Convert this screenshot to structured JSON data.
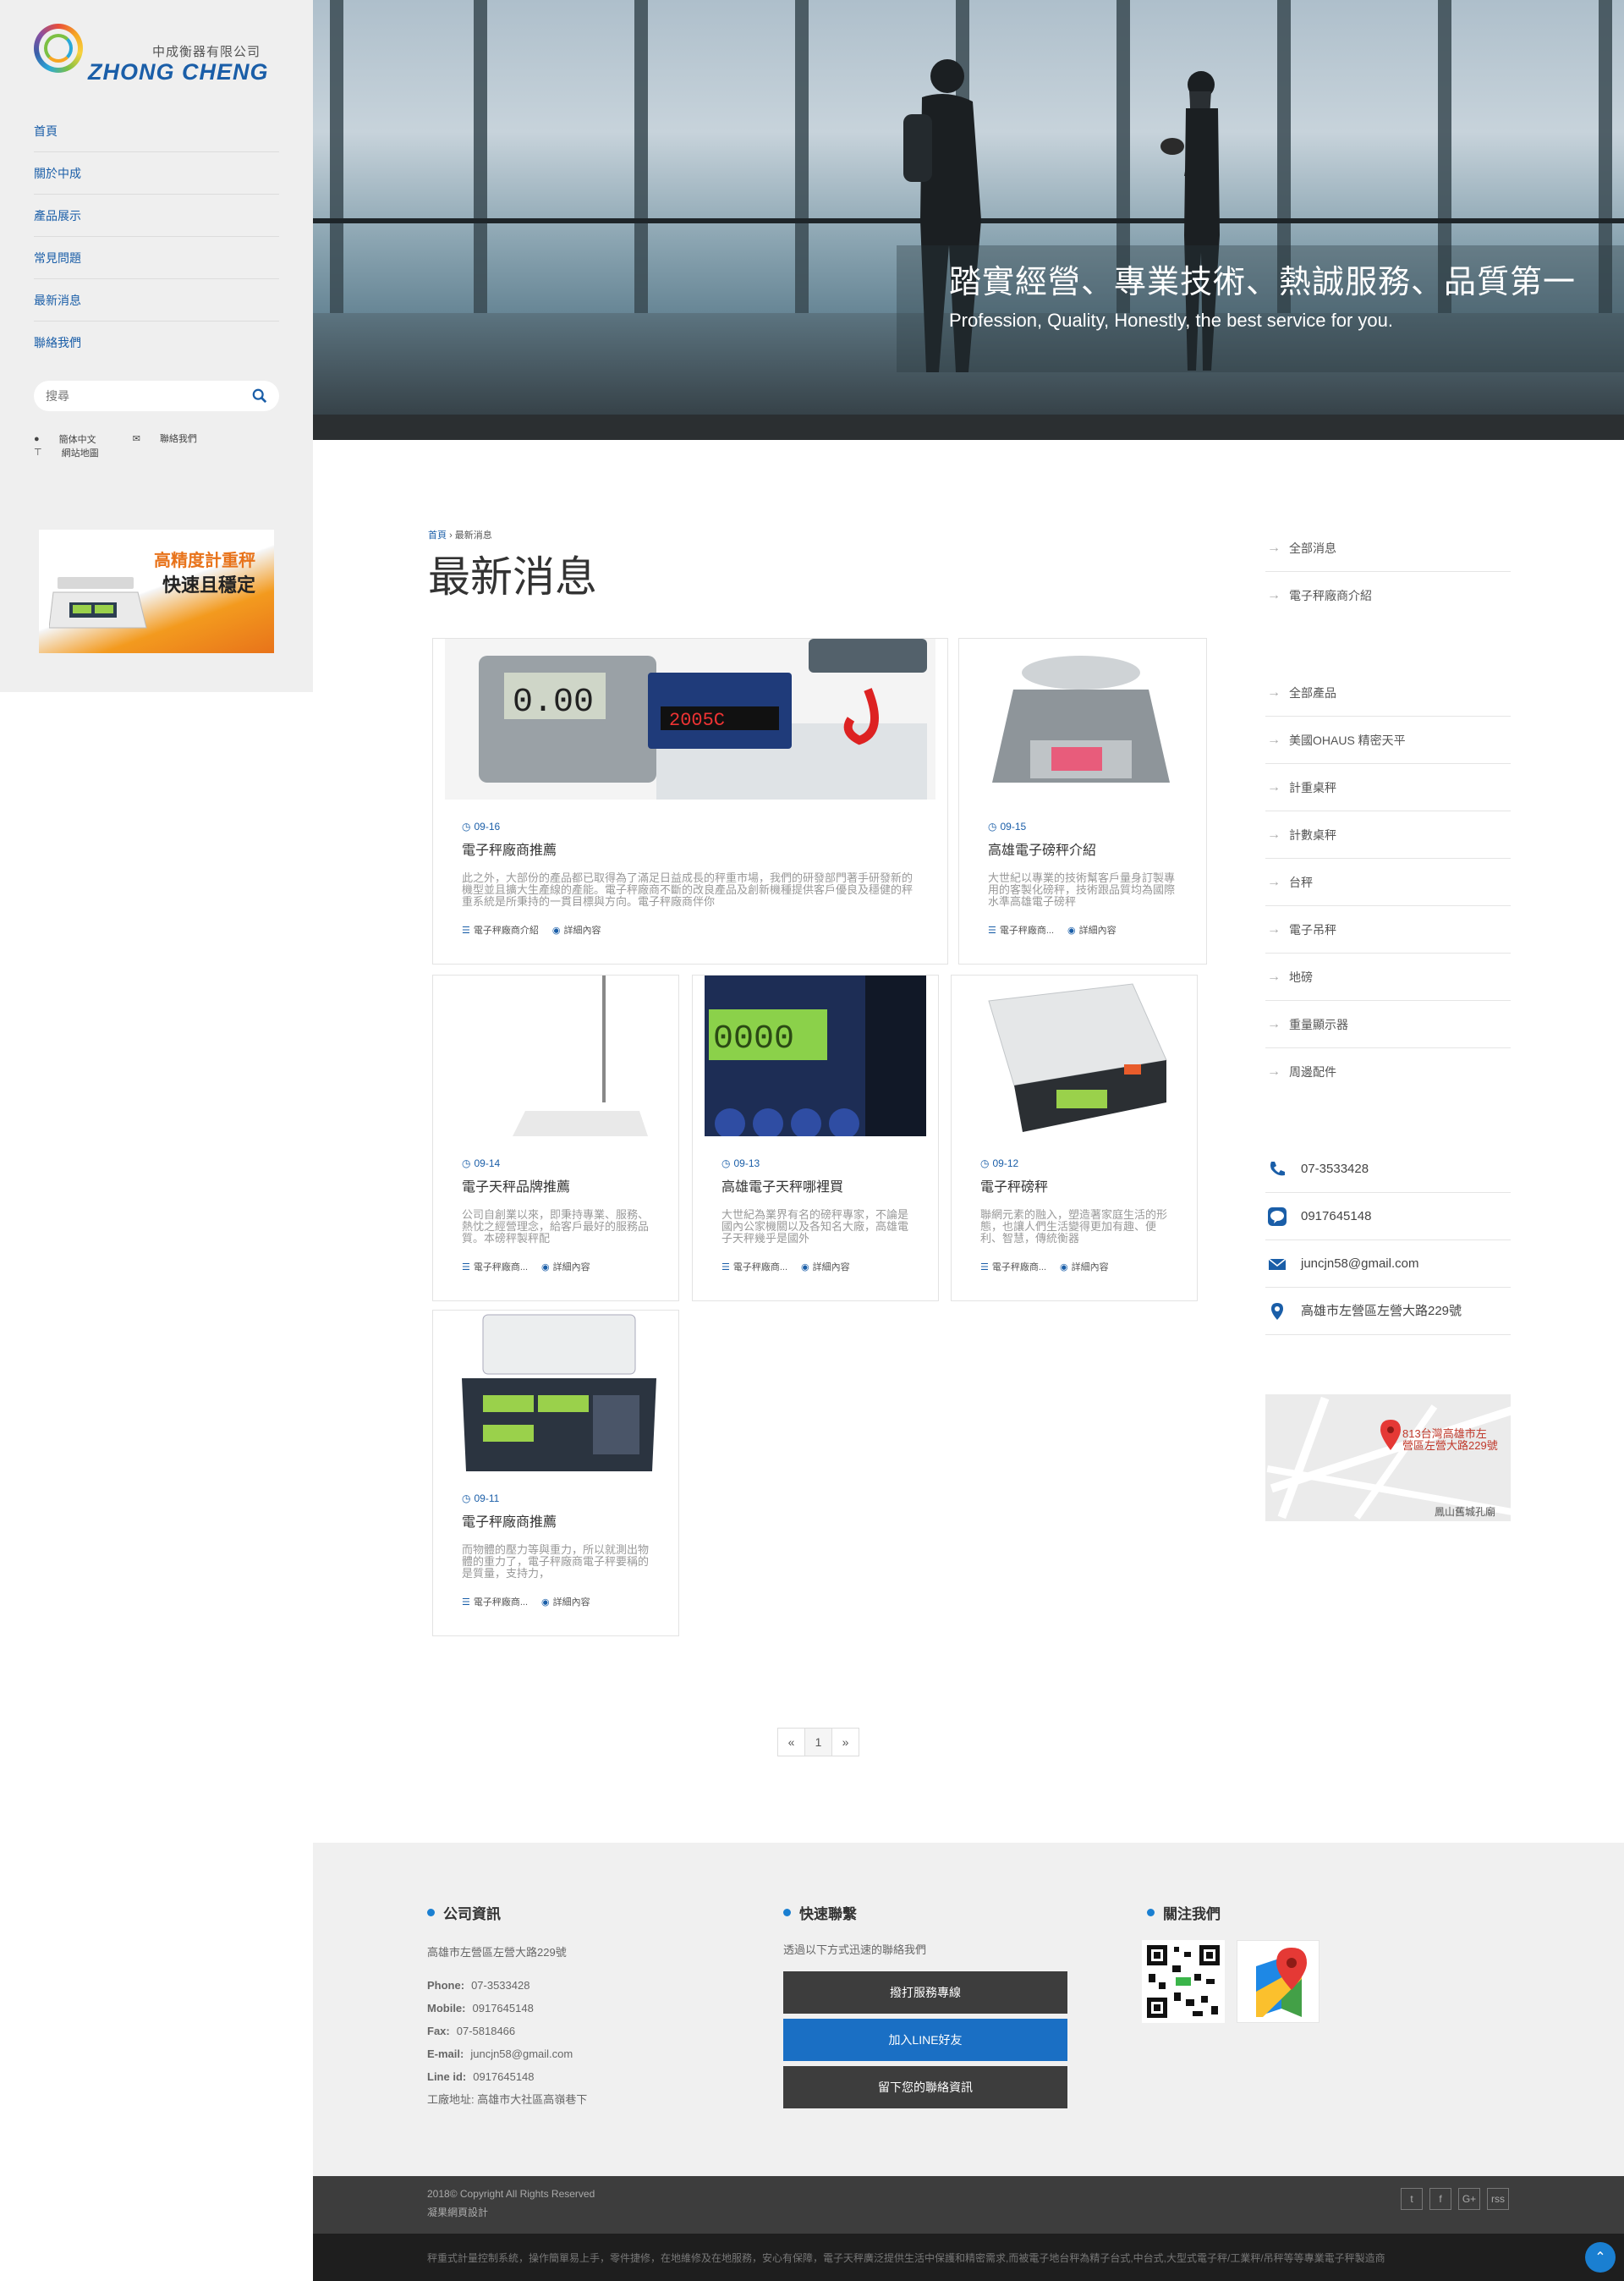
{
  "logo": {
    "cn": "中成衡器有限公司",
    "en": "ZHONG CHENG"
  },
  "nav": [
    {
      "label": "首頁"
    },
    {
      "label": "關於中成"
    },
    {
      "label": "產品展示"
    },
    {
      "label": "常見問題"
    },
    {
      "label": "最新消息"
    },
    {
      "label": "聯絡我們"
    }
  ],
  "search": {
    "placeholder": "搜尋"
  },
  "utility": {
    "lang": "簡体中文",
    "contact": "聯絡我們",
    "sitemap": "網站地圖"
  },
  "promo": {
    "line1": "高精度計重秤",
    "line2": "快速且穩定"
  },
  "hero": {
    "title": "踏實經營、專業技術、熱誠服務、品質第一",
    "subtitle": "Profession, Quality, Honestly, the best service for you."
  },
  "breadcrumb": {
    "home": "首頁",
    "current": "最新消息"
  },
  "page_title": "最新消息",
  "articles": [
    {
      "date": "09-16",
      "title": "電子秤廠商推薦",
      "excerpt": "此之外，大部份的產品都已取得為了滿足日益成長的秤重市場，我們的研發部門著手研發新的機型並且擴大生產線的產能。電子秤廠商不斷的改良產品及創新機種提供客戶優良及穩健的秤重系統是所秉持的一貫目標與方向。電子秤廠商伴你",
      "category": "電子秤廠商介紹",
      "more": "詳細內容"
    },
    {
      "date": "09-15",
      "title": "高雄電子磅秤介紹",
      "excerpt": "大世紀以專業的技術幫客戶量身訂製專用的客製化磅秤，技術跟品質均為國際水準高雄電子磅秤",
      "category": "電子秤廠商...",
      "more": "詳細內容"
    },
    {
      "date": "09-14",
      "title": "電子天秤品牌推薦",
      "excerpt": "公司自創業以來，即秉持專業、服務、熱忱之經營理念，給客戶最好的服務品質。本磅秤製秤配",
      "category": "電子秤廠商...",
      "more": "詳細內容"
    },
    {
      "date": "09-13",
      "title": "高雄電子天秤哪裡買",
      "excerpt": "大世紀為業界有名的磅秤專家，不論是國內公家機關以及各知名大廠，高雄電子天秤幾乎是國外",
      "category": "電子秤廠商...",
      "more": "詳細內容"
    },
    {
      "date": "09-12",
      "title": "電子秤磅秤",
      "excerpt": "聯網元素的融入，塑造著家庭生活的形態，也讓人們生活變得更加有趣、便利、智慧，傳統衡器",
      "category": "電子秤廠商...",
      "more": "詳細內容"
    },
    {
      "date": "09-11",
      "title": "電子秤廠商推薦",
      "excerpt": "而物體的壓力等與重力，所以就測出物體的重力了，電子秤廠商電子秤要稱的是質量，支持力，",
      "category": "電子秤廠商...",
      "more": "詳細內容"
    }
  ],
  "right_news": [
    "全部消息",
    "電子秤廠商介紹"
  ],
  "right_products": [
    "全部產品",
    "美國OHAUS 精密天平",
    "計重桌秤",
    "計數桌秤",
    "台秤",
    "電子吊秤",
    "地磅",
    "重量顯示器",
    "周邊配件"
  ],
  "contact": {
    "phone": "07-3533428",
    "line": "0917645148",
    "email": "juncjn58@gmail.com",
    "address": "高雄市左營區左營大路229號"
  },
  "map": {
    "label_line1": "813台灣高雄市左",
    "label_line2": "營區左營大路229號",
    "place": "鳳山舊城孔廟"
  },
  "pagination": {
    "prev": "«",
    "current": "1",
    "next": "»"
  },
  "footer": {
    "company_title": "公司資訊",
    "address": "高雄市左營區左營大路229號",
    "phone_label": "Phone:",
    "phone": "07-3533428",
    "mobile_label": "Mobile:",
    "mobile": "0917645148",
    "fax_label": "Fax:",
    "fax": "07-5818466",
    "email_label": "E-mail:",
    "email": "juncjn58@gmail.com",
    "lineid_label": "Line id:",
    "lineid": "0917645148",
    "factory_label": "工廠地址:",
    "factory": "高雄市大社區高嶺巷下",
    "quick_title": "快速聯繫",
    "quick_text": "透過以下方式迅速的聯絡我們",
    "btn_call": "撥打服務專線",
    "btn_line": "加入LINE好友",
    "btn_leave": "留下您的聯絡資訊",
    "follow_title": "關注我們"
  },
  "copyright": {
    "line1": "2018© Copyright All Rights Reserved",
    "line2": "凝果網頁設計"
  },
  "social": [
    "t",
    "f",
    "G+",
    "rss"
  ],
  "bottom_text": "秤重式計量控制系統，操作簡單易上手，零件捷修，在地維修及在地服務，安心有保障，電子天秤廣泛提供生活中保護和精密需求,而被電子地台秤為精子台式,中台式,大型式電子秤/工業秤/吊秤等等專業電子秤製造商",
  "colors": {
    "brand": "#1a5ea8",
    "accent": "#1a7fd1",
    "button_dark": "#3d3d3d",
    "button_line": "#1a6fc4"
  }
}
